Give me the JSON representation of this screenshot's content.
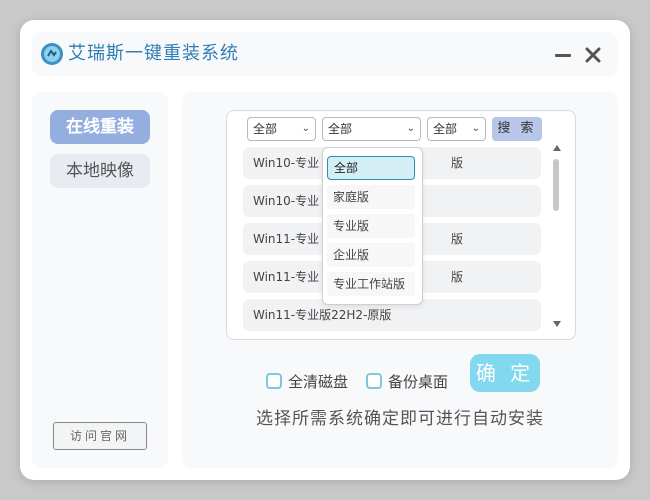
{
  "app": {
    "title": "艾瑞斯一键重装系统"
  },
  "sidebar": {
    "online_label": "在线重装",
    "local_label": "本地映像",
    "visit_label": "访问官网"
  },
  "filters": {
    "filter1": "全部",
    "filter2": "全部",
    "filter3": "全部",
    "search_label": "搜 索"
  },
  "list": {
    "rows": [
      {
        "prefix": "Win10-专业",
        "tail": "版"
      },
      {
        "prefix": "Win10-专业",
        "tail": ""
      },
      {
        "prefix": "Win11-专业",
        "tail": "版"
      },
      {
        "prefix": "Win11-专业",
        "tail": "版"
      },
      {
        "prefix": "Win11-专业版22H2-原版",
        "tail": ""
      }
    ]
  },
  "dropdown": {
    "options": [
      "全部",
      "家庭版",
      "专业版",
      "企业版",
      "专业工作站版"
    ],
    "selected": "全部"
  },
  "options": {
    "clear_disk": "全清磁盘",
    "backup_desktop": "备份桌面"
  },
  "confirm_label": "确 定",
  "hint": "选择所需系统确定即可进行自动安装",
  "colors": {
    "title": "#2f7fb5",
    "nav_active": "#95aee0",
    "confirm": "#82d8ee",
    "search": "#b8c6ea"
  }
}
